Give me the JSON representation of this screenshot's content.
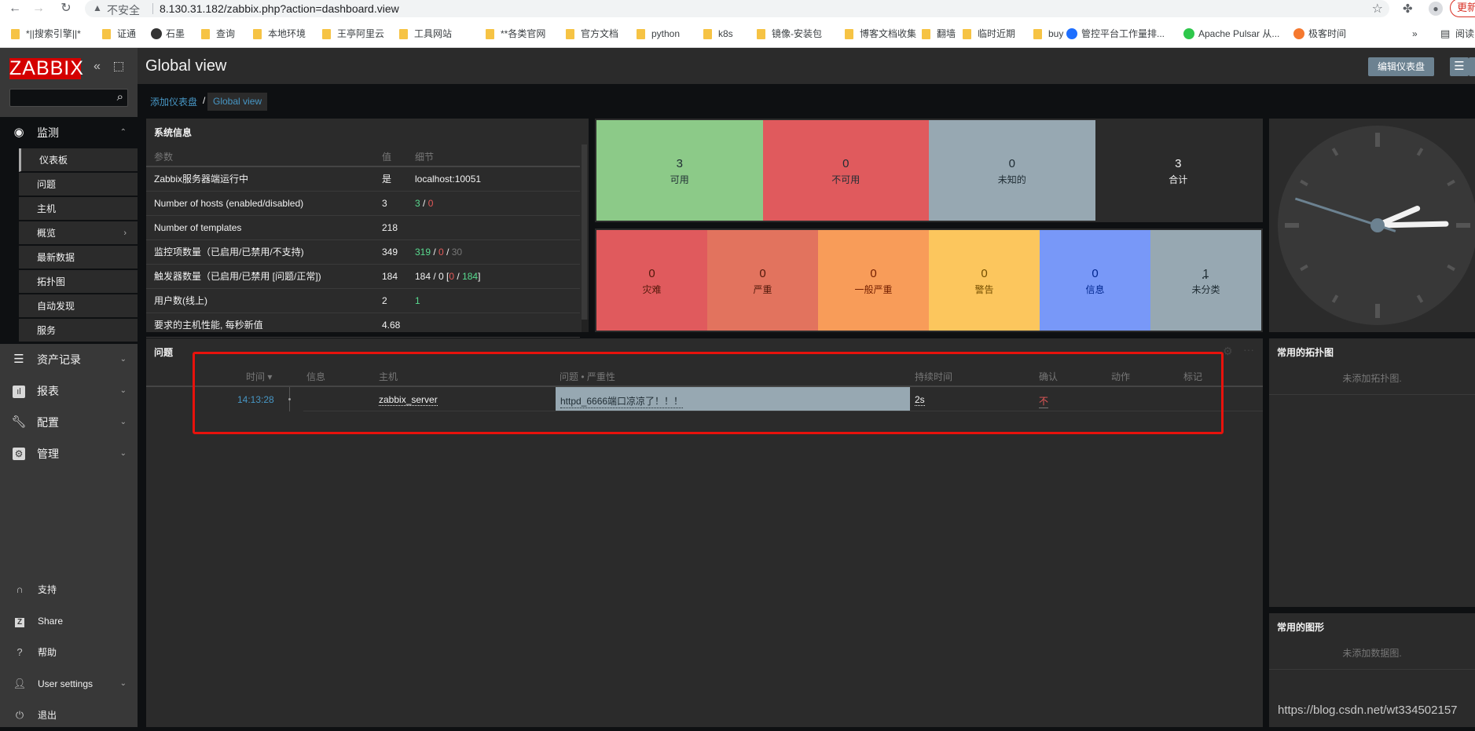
{
  "browser": {
    "security_label": "不安全",
    "url": "8.130.31.182/zabbix.php?action=dashboard.view",
    "update_label": "更新",
    "bookmarks": [
      {
        "label": "*||搜索引擎||*",
        "type": "folder"
      },
      {
        "label": "证通",
        "type": "folder"
      },
      {
        "label": "石墨",
        "type": "site"
      },
      {
        "label": "查询",
        "type": "folder"
      },
      {
        "label": "本地环境",
        "type": "folder"
      },
      {
        "label": "王亭阿里云",
        "type": "folder"
      },
      {
        "label": "工具网站",
        "type": "folder"
      },
      {
        "label": "**各类官网",
        "type": "folder"
      },
      {
        "label": "官方文档",
        "type": "folder"
      },
      {
        "label": "python",
        "type": "folder"
      },
      {
        "label": "k8s",
        "type": "folder"
      },
      {
        "label": "镜像-安装包",
        "type": "folder"
      },
      {
        "label": "博客文档收集",
        "type": "folder"
      },
      {
        "label": "翻墙",
        "type": "folder"
      },
      {
        "label": "临时近期",
        "type": "folder"
      },
      {
        "label": "buy",
        "type": "folder"
      },
      {
        "label": "管控平台工作量排...",
        "type": "site"
      },
      {
        "label": "Apache Pulsar 从...",
        "type": "site"
      },
      {
        "label": "极客时间",
        "type": "site"
      }
    ],
    "more_label": "»",
    "reading_list_label": "阅读"
  },
  "sidebar": {
    "logo": "ZABBIX",
    "search_placeholder": "",
    "groups": [
      {
        "label": "监测",
        "icon": "eye-icon",
        "expanded": true
      },
      {
        "label": "资产记录",
        "icon": "list-icon"
      },
      {
        "label": "报表",
        "icon": "chart-icon"
      },
      {
        "label": "配置",
        "icon": "wrench-icon"
      },
      {
        "label": "管理",
        "icon": "gear-icon"
      }
    ],
    "monitor_items": [
      "仪表板",
      "问题",
      "主机",
      "概览",
      "最新数据",
      "拓扑图",
      "自动发现",
      "服务"
    ],
    "bottom_items": [
      {
        "label": "支持",
        "icon": "headset-icon"
      },
      {
        "label": "Share",
        "icon": "share-icon"
      },
      {
        "label": "帮助",
        "icon": "help-icon"
      },
      {
        "label": "User settings",
        "icon": "user-icon"
      },
      {
        "label": "退出",
        "icon": "power-icon"
      }
    ]
  },
  "header": {
    "title": "Global view",
    "edit_label": "编辑仪表盘"
  },
  "breadcrumb": {
    "parent": "添加仪表盘",
    "separator": "/",
    "current": "Global view"
  },
  "system_info": {
    "title": "系统信息",
    "columns": [
      "参数",
      "值",
      "细节"
    ],
    "rows": [
      {
        "param": "Zabbix服务器端运行中",
        "value": "是",
        "details": "localhost:10051"
      },
      {
        "param": "Number of hosts (enabled/disabled)",
        "value": "3",
        "details_parts": [
          "3",
          " / ",
          "0"
        ]
      },
      {
        "param": "Number of templates",
        "value": "218",
        "details": ""
      },
      {
        "param": "监控项数量（已启用/已禁用/不支持)",
        "value": "349",
        "details_parts": [
          "319",
          " / ",
          "0",
          " / ",
          "30"
        ]
      },
      {
        "param": "触发器数量（已启用/已禁用 [问题/正常])",
        "value": "184",
        "details_parts": [
          "184 / 0 [",
          "0",
          " / ",
          "184",
          "]"
        ]
      },
      {
        "param": "用户数(线上)",
        "value": "2",
        "details": "1"
      },
      {
        "param": "要求的主机性能, 每秒新值",
        "value": "4.68",
        "details": ""
      }
    ]
  },
  "host_availability": [
    {
      "count": "3",
      "label": "可用",
      "color": "#8cca88",
      "text": "#1f2c33"
    },
    {
      "count": "0",
      "label": "不可用",
      "color": "#e05a5d",
      "text": "#1f2c33"
    },
    {
      "count": "0",
      "label": "未知的",
      "color": "#97a8b2",
      "text": "#1f2c33"
    },
    {
      "count": "3",
      "label": "合计",
      "color": "#2b2b2b",
      "text": "#f2f2f2"
    }
  ],
  "problems_by_severity": [
    {
      "count": "0",
      "label": "灾难",
      "color": "#e05a5d",
      "text": "#52190b"
    },
    {
      "count": "0",
      "label": "严重",
      "color": "#e2735e",
      "text": "#52190b"
    },
    {
      "count": "0",
      "label": "一般严重",
      "color": "#f89c59",
      "text": "#731f00"
    },
    {
      "count": "0",
      "label": "警告",
      "color": "#fcc65d",
      "text": "#734d00"
    },
    {
      "count": "0",
      "label": "信息",
      "color": "#7898f8",
      "text": "#00268e"
    },
    {
      "count": "1",
      "label": "未分类",
      "color": "#97a8b2",
      "text": "#1f2c33"
    }
  ],
  "clock": {
    "hours": 2,
    "minutes": 14,
    "seconds": 48
  },
  "problems": {
    "title": "问题",
    "columns": [
      "时间 ▾",
      "信息",
      "主机",
      "问题 • 严重性",
      "持续时间",
      "确认",
      "动作",
      "标记"
    ],
    "rows": [
      {
        "time": "14:13:28",
        "info": "",
        "host": "zabbix_server",
        "problem": "httpd_6666端口凉凉了！！！",
        "duration": "2s",
        "ack": "不",
        "actions": "",
        "tags": ""
      }
    ]
  },
  "favorite_maps": {
    "title": "常用的拓扑图",
    "empty": "未添加拓扑图."
  },
  "favorite_graphs": {
    "title": "常用的图形",
    "empty": "未添加数据图."
  },
  "watermark": "https://blog.csdn.net/wt334502157"
}
